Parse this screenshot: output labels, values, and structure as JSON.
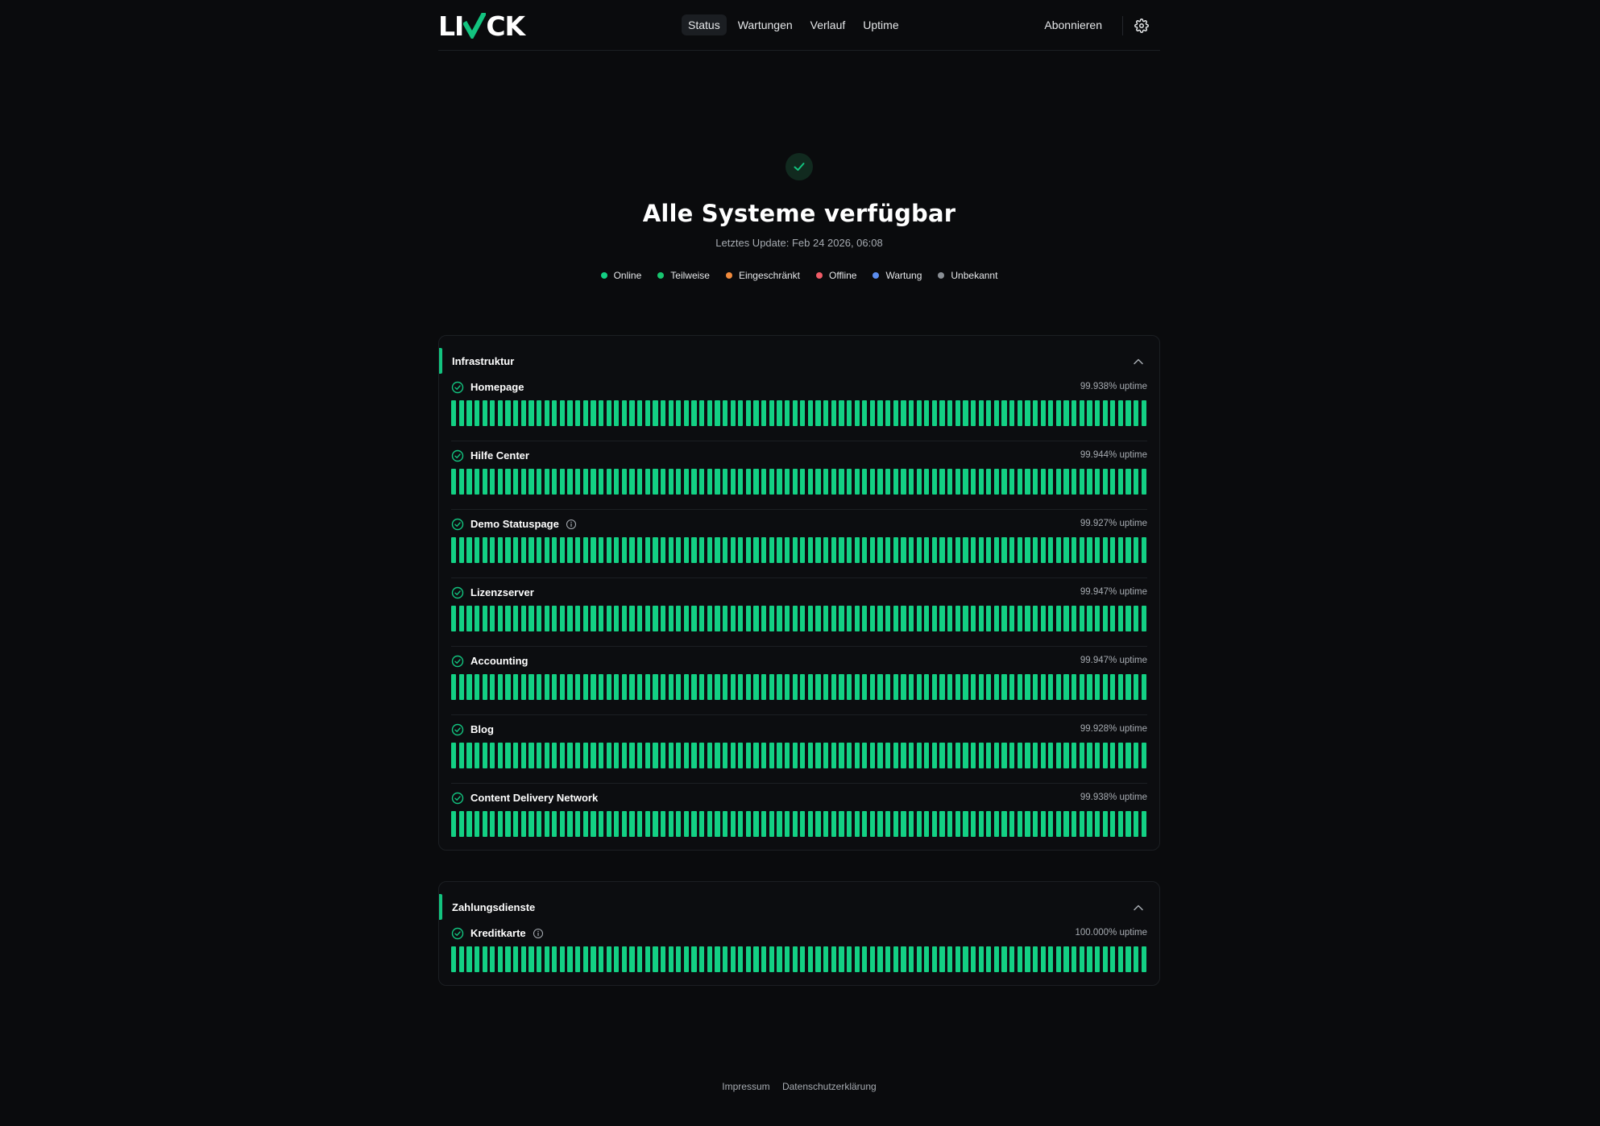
{
  "brand": {
    "logo_left": "LI",
    "logo_right": "CK",
    "accent": "#13c37f"
  },
  "nav": {
    "items": [
      "Status",
      "Wartungen",
      "Verlauf",
      "Uptime"
    ],
    "active": "Status"
  },
  "header": {
    "subscribe_label": "Abonnieren",
    "settings_icon": "gear-icon"
  },
  "hero": {
    "icon": "check-icon",
    "title": "Alle Systeme verfügbar",
    "subtitle": "Letztes Update: Feb 24 2026, 06:08"
  },
  "legend": [
    {
      "label": "Online",
      "color": "#13d084"
    },
    {
      "label": "Teilweise",
      "color": "#18c56f"
    },
    {
      "label": "Eingeschränkt",
      "color": "#f08a3c"
    },
    {
      "label": "Offline",
      "color": "#ef5b66"
    },
    {
      "label": "Wartung",
      "color": "#5b8def"
    },
    {
      "label": "Unbekannt",
      "color": "#8a8f95"
    }
  ],
  "bar_color": "#13d084",
  "bar_count": 90,
  "groups": [
    {
      "title": "Infrastruktur",
      "services": [
        {
          "name": "Homepage",
          "uptime": "99.938% uptime",
          "info": false
        },
        {
          "name": "Hilfe Center",
          "uptime": "99.944% uptime",
          "info": false
        },
        {
          "name": "Demo Statuspage",
          "uptime": "99.927% uptime",
          "info": true
        },
        {
          "name": "Lizenzserver",
          "uptime": "99.947% uptime",
          "info": false
        },
        {
          "name": "Accounting",
          "uptime": "99.947% uptime",
          "info": false
        },
        {
          "name": "Blog",
          "uptime": "99.928% uptime",
          "info": false
        },
        {
          "name": "Content Delivery Network",
          "uptime": "99.938% uptime",
          "info": false
        }
      ]
    },
    {
      "title": "Zahlungsdienste",
      "services": [
        {
          "name": "Kreditkarte",
          "uptime": "100.000% uptime",
          "info": true
        }
      ]
    }
  ],
  "footer": {
    "imprint": "Impressum",
    "privacy": "Datenschutzerklärung"
  }
}
